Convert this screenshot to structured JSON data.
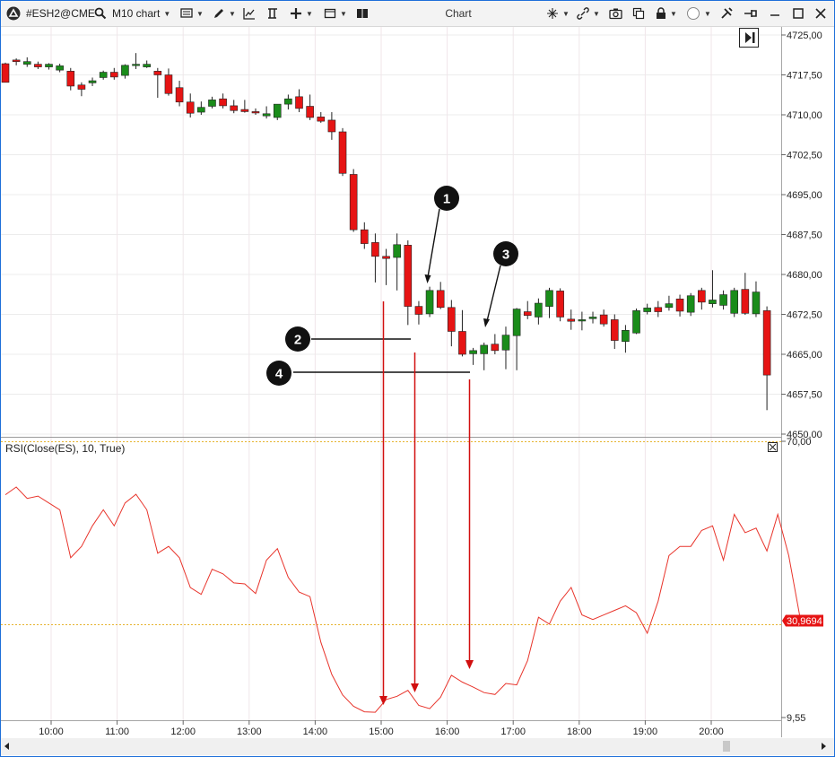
{
  "toolbar": {
    "symbol": "#ESH2@CME",
    "timeframe": "M10 chart",
    "window_title": "Chart"
  },
  "chart_data": [
    {
      "type": "candlestick",
      "y_ticks": [
        "4725,00",
        "4717,50",
        "4710,00",
        "4702,50",
        "4695,00",
        "4687,50",
        "4680,00",
        "4672,50",
        "4665,00",
        "4657,50",
        "4650,00"
      ],
      "x_ticks": [
        "10:00",
        "11:00",
        "12:00",
        "13:00",
        "14:00",
        "15:00",
        "16:00",
        "17:00",
        "18:00",
        "19:00",
        "20:00"
      ],
      "ylim": [
        4650,
        4725
      ],
      "grid": true,
      "candles": [
        [
          4719.6,
          4719.8,
          4717.0,
          4716.1
        ],
        [
          4720.3,
          4720.6,
          4719.3,
          4720.0
        ],
        [
          4719.5,
          4720.8,
          4719.0,
          4720.0
        ],
        [
          4719.5,
          4720.0,
          4718.6,
          4719.0
        ],
        [
          4719.0,
          4719.7,
          4718.5,
          4719.5
        ],
        [
          4718.4,
          4719.6,
          4718.0,
          4719.2
        ],
        [
          4718.2,
          4718.8,
          4714.6,
          4715.4
        ],
        [
          4715.6,
          4716.1,
          4713.5,
          4714.8
        ],
        [
          4716.0,
          4717.0,
          4715.4,
          4716.4
        ],
        [
          4717.0,
          4718.3,
          4716.6,
          4718.0
        ],
        [
          4718.0,
          4718.8,
          4716.6,
          4717.1
        ],
        [
          4717.4,
          4719.5,
          4716.8,
          4719.3
        ],
        [
          4719.3,
          4721.6,
          4718.6,
          4719.5
        ],
        [
          4719.0,
          4720.2,
          4718.8,
          4719.5
        ],
        [
          4718.2,
          4718.8,
          4713.2,
          4717.5
        ],
        [
          4717.5,
          4718.7,
          4713.6,
          4714.0
        ],
        [
          4715.1,
          4716.4,
          4711.6,
          4712.4
        ],
        [
          4712.4,
          4714.0,
          4709.5,
          4710.3
        ],
        [
          4710.5,
          4712.5,
          4710.0,
          4711.4
        ],
        [
          4711.6,
          4713.4,
          4711.2,
          4712.8
        ],
        [
          4713.0,
          4714.0,
          4711.2,
          4711.7
        ],
        [
          4711.7,
          4712.8,
          4710.3,
          4710.8
        ],
        [
          4711.0,
          4712.8,
          4710.4,
          4710.6
        ],
        [
          4710.6,
          4711.2,
          4710.0,
          4710.5
        ],
        [
          4709.8,
          4711.6,
          4709.3,
          4710.2
        ],
        [
          4709.5,
          4712.0,
          4709.0,
          4712.0
        ],
        [
          4712.0,
          4713.8,
          4711.0,
          4713.0
        ],
        [
          4713.4,
          4714.8,
          4710.5,
          4711.2
        ],
        [
          4711.6,
          4713.8,
          4709.0,
          4709.5
        ],
        [
          4709.6,
          4710.5,
          4708.5,
          4708.8
        ],
        [
          4709.0,
          4710.5,
          4705.3,
          4706.8
        ],
        [
          4706.8,
          4707.5,
          4698.5,
          4699.0
        ],
        [
          4698.8,
          4699.8,
          4688.0,
          4688.4
        ],
        [
          4688.4,
          4689.8,
          4684.8,
          4685.8
        ],
        [
          4686.0,
          4687.7,
          4678.5,
          4683.4
        ],
        [
          4683.4,
          4684.8,
          4678.0,
          4683.0
        ],
        [
          4683.2,
          4687.7,
          4677.0,
          4685.6
        ],
        [
          4685.5,
          4686.4,
          4670.5,
          4674.0
        ],
        [
          4674.0,
          4675.0,
          4670.6,
          4672.5
        ],
        [
          4672.6,
          4677.7,
          4672.0,
          4677.0
        ],
        [
          4677.0,
          4678.6,
          4673.5,
          4673.8
        ],
        [
          4673.8,
          4675.2,
          4666.5,
          4669.3
        ],
        [
          4669.3,
          4673.3,
          4664.6,
          4665.0
        ],
        [
          4665.1,
          4666.2,
          4663.0,
          4665.7
        ],
        [
          4665.1,
          4667.2,
          4662.0,
          4666.7
        ],
        [
          4666.9,
          4668.8,
          4665.0,
          4665.7
        ],
        [
          4665.8,
          4670.2,
          4662.2,
          4668.6
        ],
        [
          4668.5,
          4673.7,
          4662.0,
          4673.5
        ],
        [
          4673.0,
          4675.0,
          4671.6,
          4672.3
        ],
        [
          4672.0,
          4675.5,
          4670.6,
          4674.6
        ],
        [
          4674.0,
          4677.5,
          4671.8,
          4677.0
        ],
        [
          4676.9,
          4677.4,
          4671.2,
          4672.0
        ],
        [
          4671.6,
          4673.4,
          4669.6,
          4671.2
        ],
        [
          4671.5,
          4673.0,
          4669.5,
          4671.5
        ],
        [
          4671.7,
          4673.0,
          4670.8,
          4672.0
        ],
        [
          4672.4,
          4673.4,
          4670.2,
          4670.7
        ],
        [
          4671.5,
          4672.5,
          4666.0,
          4667.6
        ],
        [
          4667.4,
          4670.5,
          4665.3,
          4669.5
        ],
        [
          4669.0,
          4673.6,
          4668.8,
          4673.2
        ],
        [
          4673.0,
          4674.5,
          4672.5,
          4673.7
        ],
        [
          4673.8,
          4675.0,
          4672.0,
          4673.0
        ],
        [
          4673.8,
          4676.0,
          4673.2,
          4674.5
        ],
        [
          4675.4,
          4676.2,
          4672.1,
          4673.1
        ],
        [
          4672.9,
          4676.5,
          4672.2,
          4676.0
        ],
        [
          4677.0,
          4677.5,
          4673.4,
          4674.8
        ],
        [
          4674.5,
          4680.8,
          4673.8,
          4675.2
        ],
        [
          4674.2,
          4677.0,
          4673.4,
          4676.2
        ],
        [
          4672.7,
          4677.5,
          4672.0,
          4677.0
        ],
        [
          4677.2,
          4680.3,
          4672.4,
          4672.7
        ],
        [
          4672.6,
          4678.7,
          4672.0,
          4676.7
        ],
        [
          4673.2,
          4674.0,
          4654.5,
          4661.1
        ]
      ]
    },
    {
      "type": "line",
      "title": "RSI(Close(ES), 10, True)",
      "y_ticks": [
        "70,00",
        "9,55"
      ],
      "last_value": "30,9694",
      "ylim": [
        9.55,
        70.0
      ],
      "grid": true,
      "values": [
        58.3,
        60.0,
        57.5,
        58.0,
        56.5,
        55.0,
        44.5,
        47.0,
        51.5,
        55.0,
        51.5,
        56.5,
        58.4,
        55.0,
        45.5,
        47.0,
        44.5,
        38.0,
        36.5,
        42.0,
        41.0,
        39.0,
        38.8,
        36.7,
        44.0,
        46.5,
        40.2,
        37.0,
        36.0,
        26.0,
        19.0,
        14.5,
        12.0,
        10.8,
        10.7,
        13.5,
        14.2,
        15.5,
        12.2,
        11.5,
        14.0,
        18.8,
        17.3,
        16.2,
        15.0,
        14.6,
        17.0,
        16.7,
        22.0,
        31.5,
        30.0,
        35.0,
        38.0,
        32.0,
        31.0,
        32.0,
        33.0,
        34.0,
        32.5,
        28.0,
        35.0,
        45.0,
        47.0,
        47.0,
        50.5,
        51.5,
        44.0,
        54.0,
        50.0,
        51.0,
        46.0,
        54.0,
        45.0,
        32.0
      ]
    }
  ],
  "annotations": {
    "markers": [
      "1",
      "2",
      "3",
      "4"
    ]
  },
  "colors": {
    "bull": "#1a8c1a",
    "bear": "#e61414",
    "rsi_line": "#e8342b",
    "badge": "#e61414",
    "dotted_line": "#e6b430",
    "arrow": "#d10f0f"
  }
}
